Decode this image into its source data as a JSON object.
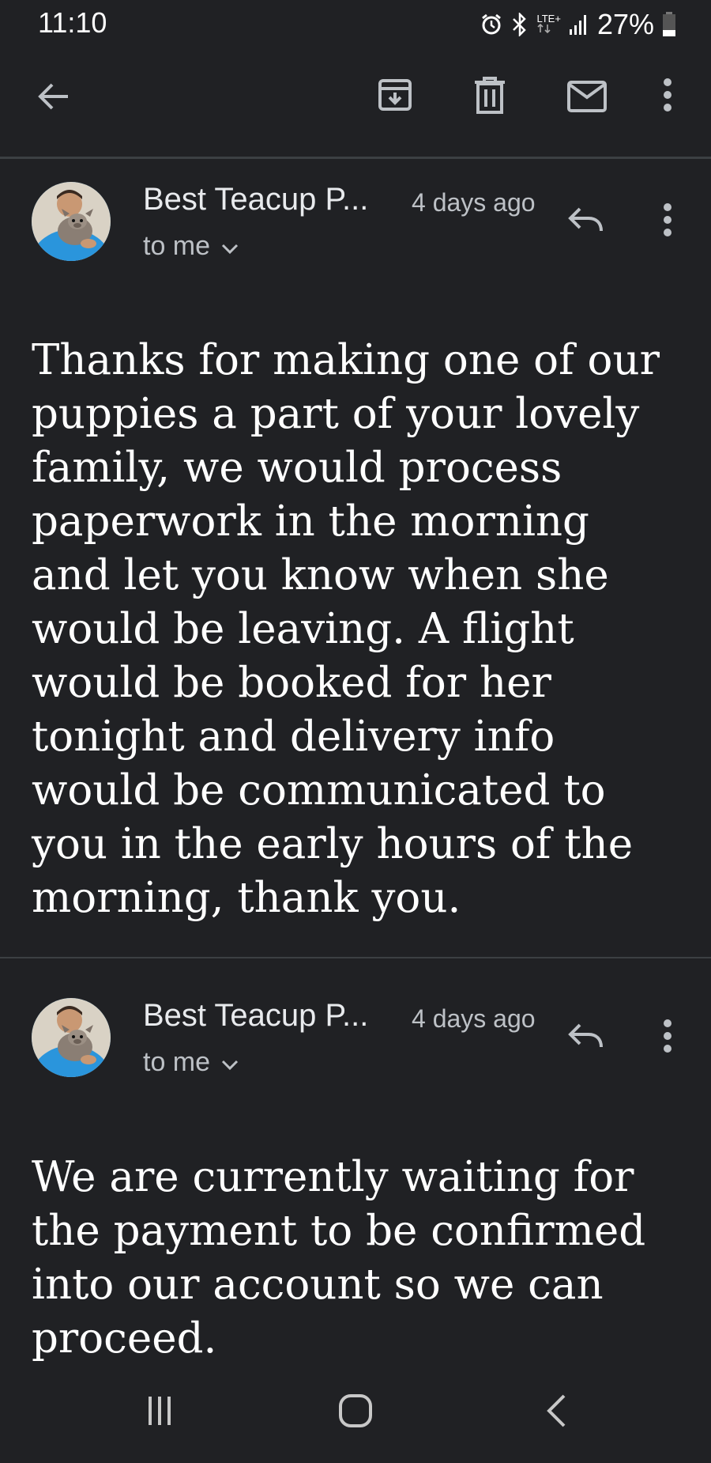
{
  "status": {
    "time": "11:10",
    "network": "LTE+",
    "battery": "27%"
  },
  "toolbar": {
    "back_icon": "arrow-back-icon",
    "archive_icon": "archive-icon",
    "delete_icon": "trash-icon",
    "mark_unread_icon": "mail-icon",
    "more_icon": "more-vert-icon"
  },
  "messages": [
    {
      "sender": "Best Teacup P...",
      "time_ago": "4 days ago",
      "recipient": "to me",
      "body": "Thanks for making one of our puppies a part of your lovely family, we would process paperwork in the morning and let you know when she would be leaving. A flight would be booked for her tonight and delivery info would be communicated to you in the early hours of the morning, thank you."
    },
    {
      "sender": "Best Teacup P...",
      "time_ago": "4 days ago",
      "recipient": "to me",
      "body": "We are currently waiting for the payment to be confirmed into our account so we can proceed."
    }
  ],
  "colors": {
    "background": "#202124",
    "text_primary": "#ffffff",
    "text_secondary": "#bdc1c6",
    "divider": "#3c4043"
  }
}
